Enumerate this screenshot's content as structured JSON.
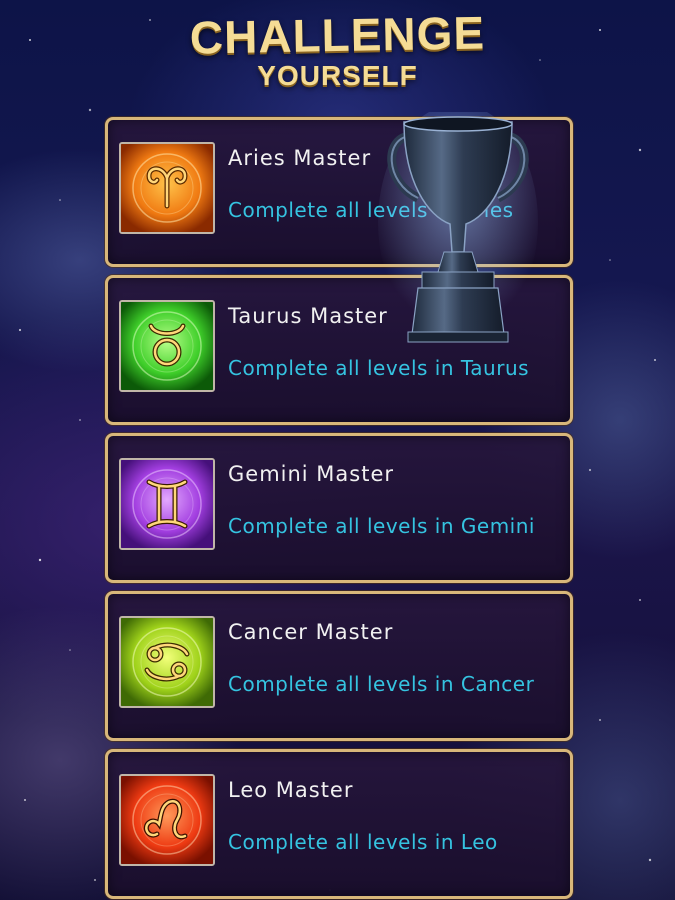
{
  "header": {
    "title": "CHALLENGE",
    "subtitle": "YOURSELF"
  },
  "achievements": [
    {
      "name": "Aries Master",
      "description": "Complete all levels in Aries",
      "sign": "aries",
      "glyph": "♈",
      "color": "#f07a12"
    },
    {
      "name": "Taurus Master",
      "description": "Complete all levels in Taurus",
      "sign": "taurus",
      "glyph": "♉",
      "color": "#3fcf2a"
    },
    {
      "name": "Gemini Master",
      "description": "Complete all levels in Gemini",
      "sign": "gemini",
      "glyph": "♊",
      "color": "#a23ee0"
    },
    {
      "name": "Cancer Master",
      "description": "Complete all levels in Cancer",
      "sign": "cancer",
      "glyph": "♋",
      "color": "#9fd21a"
    },
    {
      "name": "Leo Master",
      "description": "Complete all levels in Leo",
      "sign": "leo",
      "glyph": "♌",
      "color": "#ee3a12"
    }
  ],
  "colors": {
    "title": "#f5dc95",
    "card_border": "#d8b77a",
    "description": "#35c3e0",
    "name": "#f1f1f1"
  },
  "icons": {
    "trophy": "trophy-icon"
  }
}
